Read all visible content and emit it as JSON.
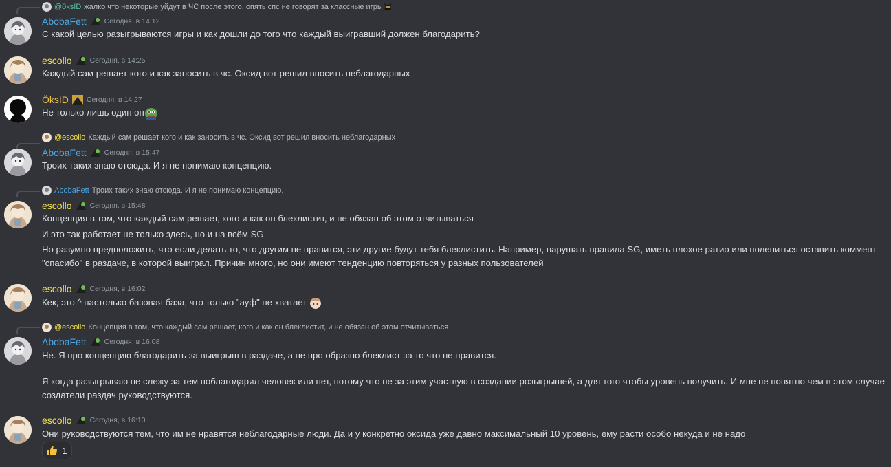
{
  "colors": {
    "background": "#313338",
    "aboba": "#4aa8e8",
    "escollo": "#f0e04a",
    "oks": "#f0c040",
    "reply_mention": "#58c0a0"
  },
  "top_reply": {
    "author": "@0ksID",
    "text": "жалко что некоторые уйдут в ЧС после этого. опять спс не говорят за классные игры"
  },
  "messages": [
    {
      "author": "AbobaFett",
      "time": "Сегодня, в 14:12",
      "lines": [
        "С какой целью разыгрываются игры и как дошли до того что каждый выигравший должен благодарить?"
      ]
    },
    {
      "author": "escollo",
      "time": "Сегодня, в 14:25",
      "lines": [
        "Каждый сам решает кого и как заносить в чс. Оксид вот решил вносить неблагодарных"
      ]
    },
    {
      "author": "ÖksID",
      "time": "Сегодня, в 14:27",
      "lines": [
        "Не только лишь один он"
      ]
    },
    {
      "reply_author": "@escollo",
      "reply_text": "Каждый сам решает кого и как заносить в чс. Оксид вот решил вносить неблагодарных",
      "author": "AbobaFett",
      "time": "Сегодня, в 15:47",
      "lines": [
        "Троих таких знаю отсюда. И я не понимаю концепцию."
      ]
    },
    {
      "reply_author": "AbobaFett",
      "reply_text": "Троих таких знаю отсюда. И я не понимаю концепцию.",
      "author": "escollo",
      "time": "Сегодня, в 15:48",
      "lines": [
        "Концепция в том, что каждый сам решает, кого и как он блеклистит, и не обязан об этом отчитываться",
        "И это так работает не только здесь, но и на всём SG",
        "Но разумно предположить, что если делать то, что другим не нравится, эти другие будут тебя блеклистить. Например, нарушать правила SG, иметь плохое ратио или полениться оставить коммент \"спасибо\" в раздаче, в которой выиграл. Причин много, но они имеют тенденцию повторяться у разных пользователей"
      ]
    },
    {
      "author": "escollo",
      "time": "Сегодня, в 16:02",
      "lines": [
        "Кек, это ^ настолько базовая база, что только \"ауф\" не хватает"
      ]
    },
    {
      "reply_author": "@escollo",
      "reply_text": "Концепция в том, что каждый сам решает, кого и как он блеклистит, и не обязан об этом отчитываться",
      "author": "AbobaFett",
      "time": "Сегодня, в 16:08",
      "lines": [
        "Не. Я про концепцию благодарить за выигрыш в раздаче, а не про образно блеклист за то что не нравится.",
        "Я когда разыгрываю не слежу за тем поблагодарил человек или нет, потому что не за этим участвую в создании розыгрышей, а для того чтобы уровень получить. И мне не понятно чем в этом случае создатели раздач руководствуются."
      ]
    },
    {
      "author": "escollo",
      "time": "Сегодня, в 16:10",
      "lines": [
        "Они руководствуются тем, что им не нравятся неблагодарные люди. Да и у конкретно оксида уже давно максимальный 10 уровень, ему расти особо некуда и не надо"
      ],
      "reaction": {
        "emoji": "thumbs-up",
        "count": "1"
      }
    }
  ]
}
